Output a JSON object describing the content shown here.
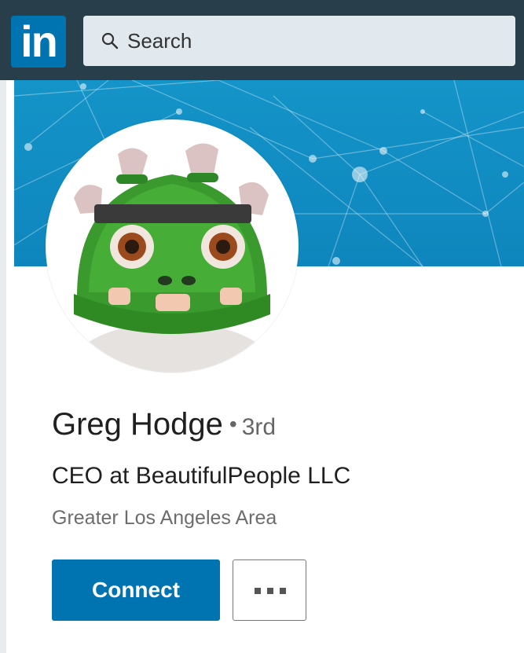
{
  "nav": {
    "logo_text": "in",
    "search_placeholder": "Search",
    "search_icon": "search-icon",
    "logo_color": "#0073b1",
    "bar_color": "#283e4a"
  },
  "profile": {
    "name": "Greg Hodge",
    "degree_separator": "•",
    "degree": "3rd",
    "headline": "CEO at BeautifulPeople LLC",
    "location": "Greater Los Angeles Area",
    "avatar": "green-monster-avatar"
  },
  "actions": {
    "connect_label": "Connect",
    "more_icon": "more-options-icon",
    "connect_color": "#0073b1"
  },
  "colors": {
    "cover": "#1494c8"
  }
}
